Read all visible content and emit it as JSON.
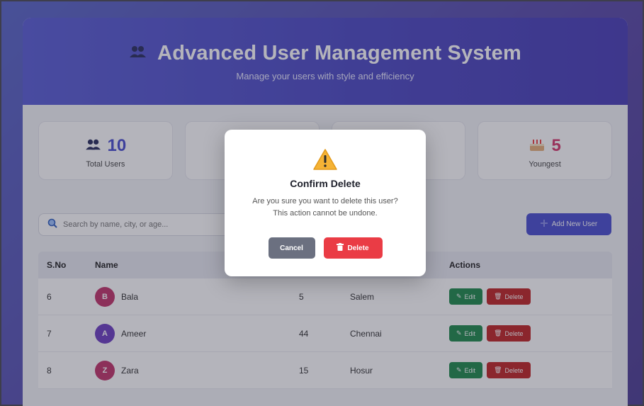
{
  "header": {
    "title": "Advanced User Management System",
    "subtitle": "Manage your users with style and efficiency",
    "icon": "users-icon"
  },
  "stats": [
    {
      "value": "10",
      "label": "Total Users",
      "icon": "users-icon"
    },
    {
      "value": "",
      "label": "",
      "icon": ""
    },
    {
      "value": "",
      "label": "",
      "icon": ""
    },
    {
      "value": "5",
      "label": "Youngest",
      "icon": "cake-icon"
    }
  ],
  "search": {
    "placeholder": "Search by name, city, or age..."
  },
  "toolbar": {
    "add_label": "Add New User"
  },
  "table": {
    "headers": {
      "sno": "S.No",
      "name": "Name",
      "age": "",
      "city": "",
      "actions": "Actions"
    },
    "edit_label": "Edit",
    "delete_label": "Delete",
    "rows": [
      {
        "sno": "6",
        "initial": "B",
        "name": "Bala",
        "age": "5",
        "city": "Salem",
        "avatar_color": "#c2356b"
      },
      {
        "sno": "7",
        "initial": "A",
        "name": "Ameer",
        "age": "44",
        "city": "Chennai",
        "avatar_color": "#6d3fc2"
      },
      {
        "sno": "8",
        "initial": "Z",
        "name": "Zara",
        "age": "15",
        "city": "Hosur",
        "avatar_color": "#c2356b"
      }
    ]
  },
  "modal": {
    "title": "Confirm Delete",
    "message_line1": "Are you sure you want to delete this user?",
    "message_line2": "This action cannot be undone.",
    "cancel_label": "Cancel",
    "delete_label": "Delete"
  },
  "colors": {
    "primary": "#4b4fd0",
    "danger": "#ea3c45",
    "success": "#1f8a4c",
    "cancel": "#6b7080"
  }
}
